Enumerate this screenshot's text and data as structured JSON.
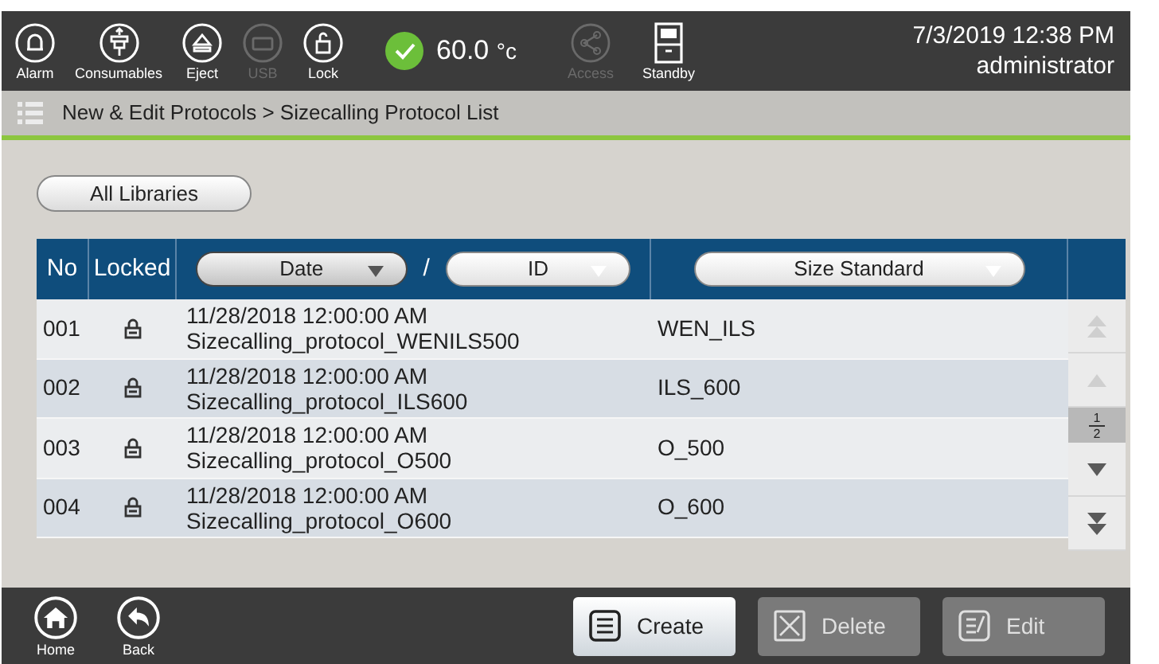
{
  "toolbar": [
    {
      "kind": "alarm",
      "label": "Alarm",
      "disabled": false
    },
    {
      "kind": "consumables",
      "label": "Consumables",
      "disabled": false
    },
    {
      "kind": "eject",
      "label": "Eject",
      "disabled": false
    },
    {
      "kind": "usb",
      "label": "USB",
      "disabled": true
    },
    {
      "kind": "lock",
      "label": "Lock",
      "disabled": false
    }
  ],
  "temperature": {
    "reading": "60.0",
    "unit": "°c",
    "ok": true
  },
  "toolbar_right": [
    {
      "kind": "access",
      "label": "Access",
      "disabled": true
    },
    {
      "kind": "standby",
      "label": "Standby",
      "disabled": false
    }
  ],
  "datetime": "7/3/2019 12:38 PM",
  "user": "administrator",
  "breadcrumb": "New & Edit Protocols > Sizecalling Protocol List",
  "filter_button": "All Libraries",
  "table": {
    "columns": [
      "No",
      "Locked"
    ],
    "sort_buttons": [
      {
        "label": "Date",
        "active": true
      },
      {
        "label": "ID",
        "active": false
      }
    ],
    "separator": "/",
    "size_sort": {
      "label": "Size Standard",
      "active": false
    },
    "rows": [
      {
        "no": "001",
        "locked": true,
        "date": "11/28/2018 12:00:00 AM",
        "id": "Sizecalling_protocol_WENILS500",
        "size_standard": "WEN_ILS"
      },
      {
        "no": "002",
        "locked": true,
        "date": "11/28/2018 12:00:00 AM",
        "id": "Sizecalling_protocol_ILS600",
        "size_standard": "ILS_600"
      },
      {
        "no": "003",
        "locked": true,
        "date": "11/28/2018 12:00:00 AM",
        "id": "Sizecalling_protocol_O500",
        "size_standard": "O_500"
      },
      {
        "no": "004",
        "locked": true,
        "date": "11/28/2018 12:00:00 AM",
        "id": "Sizecalling_protocol_O600",
        "size_standard": "O_600"
      }
    ],
    "pager": {
      "page": "1",
      "pages": "2",
      "first_disabled": true,
      "prev_disabled": true,
      "next_disabled": false,
      "last_disabled": false
    }
  },
  "nav": [
    {
      "kind": "home",
      "label": "Home"
    },
    {
      "kind": "back",
      "label": "Back"
    }
  ],
  "actions": [
    {
      "kind": "create",
      "label": "Create",
      "disabled": false
    },
    {
      "kind": "delete",
      "label": "Delete",
      "disabled": true
    },
    {
      "kind": "edit",
      "label": "Edit",
      "disabled": true
    }
  ]
}
